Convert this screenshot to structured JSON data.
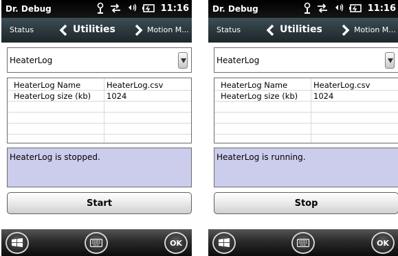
{
  "screens": [
    {
      "app_title": "Dr. Debug",
      "clock": "11:16",
      "nav": {
        "prev": "Status",
        "current": "Utilities",
        "next": "Motion M..."
      },
      "dropdown": {
        "selected": "HeaterLog"
      },
      "properties": [
        {
          "name": "HeaterLog Name",
          "value": "HeaterLog.csv"
        },
        {
          "name": "HeaterLog size (kb)",
          "value": "1024"
        }
      ],
      "message": "HeaterLog is stopped.",
      "action_button": "Start",
      "taskbar": {
        "ok_label": "OK"
      }
    },
    {
      "app_title": "Dr. Debug",
      "clock": "11:16",
      "nav": {
        "prev": "Status",
        "current": "Utilities",
        "next": "Motion M..."
      },
      "dropdown": {
        "selected": "HeaterLog"
      },
      "properties": [
        {
          "name": "HeaterLog Name",
          "value": "HeaterLog.csv"
        },
        {
          "name": "HeaterLog size (kb)",
          "value": "1024"
        }
      ],
      "message": "HeaterLog is running.",
      "action_button": "Stop",
      "taskbar": {
        "ok_label": "OK"
      }
    }
  ],
  "icons": {
    "status": [
      "signal-icon",
      "connectivity-icon",
      "volume-icon",
      "battery-icon"
    ],
    "nav": [
      "chevron-left-icon",
      "chevron-right-icon"
    ],
    "taskbar": [
      "windows-start-icon",
      "keyboard-icon",
      "ok-icon"
    ],
    "dropdown": "dropdown-arrow-icon"
  },
  "colors": {
    "message_background": "#ccccec",
    "navbar": "#2f3d42",
    "statusbar": "#000000"
  }
}
